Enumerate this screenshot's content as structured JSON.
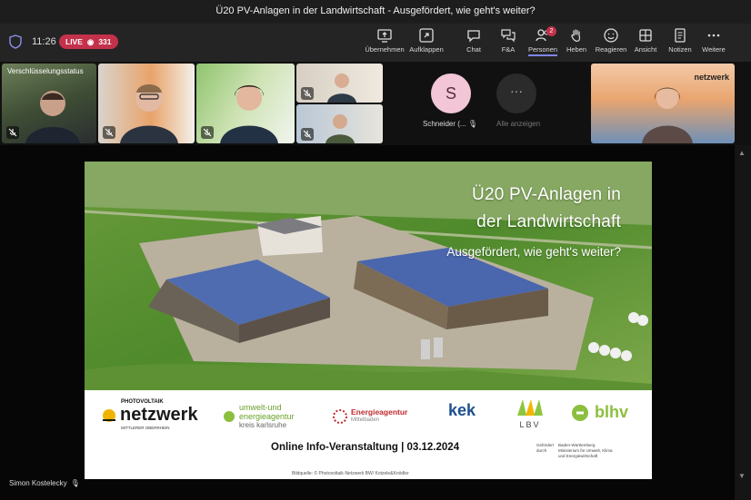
{
  "window": {
    "title": "Ü20 PV-Anlagen in der Landwirtschaft - Ausgefördert, wie geht's weiter?"
  },
  "toolbar": {
    "time": "11:26",
    "live_label": "LIVE",
    "viewer_count": "331",
    "buttons": [
      {
        "label": "Übernehmen",
        "icon": "share-screen-icon"
      },
      {
        "label": "Aufklappen",
        "icon": "expand-icon"
      },
      {
        "label": "Chat",
        "icon": "chat-icon"
      },
      {
        "label": "F&A",
        "icon": "qa-icon"
      },
      {
        "label": "Personen",
        "icon": "people-icon",
        "badge": "2",
        "active": true
      },
      {
        "label": "Heben",
        "icon": "hand-icon"
      },
      {
        "label": "Reagieren",
        "icon": "smiley-icon"
      },
      {
        "label": "Ansicht",
        "icon": "grid-icon"
      },
      {
        "label": "Notizen",
        "icon": "notes-icon"
      },
      {
        "label": "Weitere",
        "icon": "more-icon"
      }
    ]
  },
  "participants": {
    "encryption_label": "Verschlüsselungsstatus",
    "avatar_initial": "S",
    "avatar_name": "Schneider (...",
    "more_label": "Alle anzeigen",
    "presenter_name": "Simon Kostelecky"
  },
  "slide": {
    "title_line1": "Ü20 PV-Anlagen in",
    "title_line2": "der Landwirtschaft",
    "subtitle": "Ausgefördert, wie geht's weiter?",
    "logos": {
      "pv_netzwerk_top": "PHOTOVOLTAIK",
      "pv_netzwerk": "netzwerk",
      "pv_netzwerk_sub": "MITTLERER OBERRHEIN",
      "uea_line1": "umwelt-und",
      "uea_line2": "energieagentur",
      "uea_line3": "kreis karlsruhe",
      "ea": "Energieagentur",
      "ea_sub": "Mittelbaden",
      "kek": "kek",
      "lbv": "LBV",
      "blhv": "blhv"
    },
    "event": "Online Info-Veranstaltung | 03.12.2024",
    "funder_label": "Gefördert durch",
    "funder_line1": "Baden-Württemberg",
    "funder_line2": "Ministerium für Umwelt, Klima",
    "funder_line3": "und Energiewirtschaft",
    "credit": "Bildquelle: © Photovoltaik-Netzwerk BW/ Kotzele&Knödler"
  },
  "colors": {
    "accent": "#7f85f5",
    "live": "#c4314b",
    "netzwerk_green": "#4a8a2e"
  }
}
